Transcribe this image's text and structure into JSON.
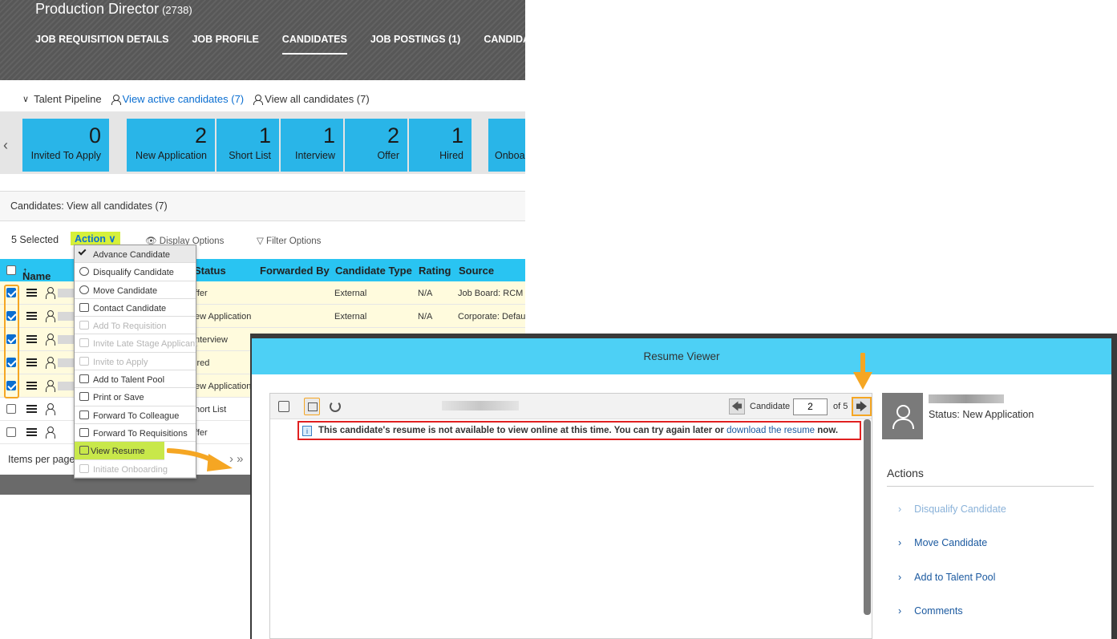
{
  "header": {
    "title": "Production Director",
    "req_id": "(2738)",
    "tabs": [
      "JOB REQUISITION DETAILS",
      "JOB PROFILE",
      "CANDIDATES",
      "JOB POSTINGS (1)",
      "CANDIDATE S"
    ]
  },
  "pipeline": {
    "label": "Talent Pipeline",
    "active_link": "View active candidates (7)",
    "all_link": "View all candidates (7)",
    "tiles": [
      {
        "count": "0",
        "label": "Invited To Apply"
      },
      {
        "count": "2",
        "label": "New Application"
      },
      {
        "count": "1",
        "label": "Short List"
      },
      {
        "count": "1",
        "label": "Interview"
      },
      {
        "count": "2",
        "label": "Offer"
      },
      {
        "count": "1",
        "label": "Hired"
      },
      {
        "count": "",
        "label": "Onboa"
      }
    ]
  },
  "candidates_header": "Candidates: View all candidates (7)",
  "toolbar": {
    "selected": "5 Selected",
    "action": "Action",
    "display_options": "Display Options",
    "filter_options": "Filter Options"
  },
  "table": {
    "columns": [
      "Name",
      "Status",
      "Forwarded By",
      "Candidate Type",
      "Rating",
      "Source"
    ],
    "rows": [
      {
        "status": "ffer",
        "type": "External",
        "rating": "N/A",
        "source": "Job Board: RCM F"
      },
      {
        "status": "ew Application",
        "type": "External",
        "rating": "N/A",
        "source": "Corporate: Defaul"
      },
      {
        "status": "nterview",
        "type": "",
        "rating": "",
        "source": ""
      },
      {
        "status": "ired",
        "type": "",
        "rating": "",
        "source": ""
      },
      {
        "status": "ew Application",
        "type": "",
        "rating": "",
        "source": ""
      },
      {
        "status": "hort List",
        "type": "",
        "rating": "",
        "source": ""
      },
      {
        "status": "ffer",
        "type": "",
        "rating": "",
        "source": ""
      }
    ]
  },
  "pager": {
    "items_per_page": "Items per page"
  },
  "dropdown": [
    {
      "label": "Advance Candidate",
      "state": "checked"
    },
    {
      "label": "Disqualify Candidate",
      "state": "normal"
    },
    {
      "label": "Move Candidate",
      "state": "normal"
    },
    {
      "label": "Contact Candidate",
      "state": "normal"
    },
    {
      "label": "Add To Requisition",
      "state": "disabled"
    },
    {
      "label": "Invite Late Stage Applicant",
      "state": "disabled"
    },
    {
      "label": "Invite to Apply",
      "state": "disabled"
    },
    {
      "label": "Add to Talent Pool",
      "state": "normal"
    },
    {
      "label": "Print or Save",
      "state": "normal"
    },
    {
      "label": "Forward To Colleague",
      "state": "normal"
    },
    {
      "label": "Forward To Requisitions",
      "state": "normal"
    },
    {
      "label": "View Resume",
      "state": "highlight"
    },
    {
      "label": "Initiate Onboarding",
      "state": "disabled"
    }
  ],
  "viewer": {
    "title": "Resume Viewer",
    "candidate_label": "Candidate",
    "candidate_index": "2",
    "of_label": "of 5",
    "message_pre": "This candidate's resume is not available to view online at this time. You can try again later or ",
    "message_link": "download the resume",
    "message_post": " now.",
    "status": "Status: New Application",
    "actions_title": "Actions",
    "actions": [
      {
        "label": "Disqualify Candidate",
        "dim": true
      },
      {
        "label": "Move Candidate",
        "dim": false
      },
      {
        "label": "Add to Talent Pool",
        "dim": false
      },
      {
        "label": "Comments",
        "dim": false
      }
    ]
  },
  "colors": {
    "accent": "#29b5e8",
    "highlight": "#d6f03a",
    "callout": "#f5a623",
    "alert": "#e02020"
  }
}
